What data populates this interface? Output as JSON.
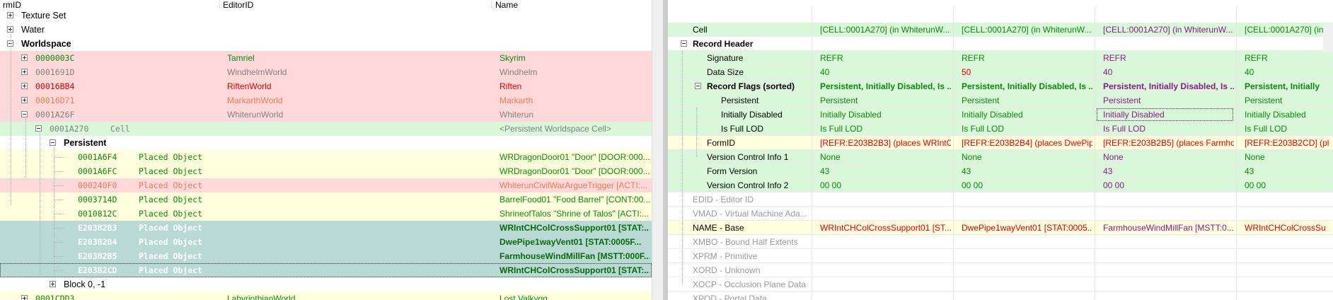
{
  "left_panel": {
    "columns": {
      "formid": "rmID",
      "editorid": "EditorID",
      "name": "Name"
    },
    "rows": [
      {
        "id": "",
        "label": "Texture Set",
        "editor": "",
        "name": "",
        "expander": "plus",
        "bold": false
      },
      {
        "id": "",
        "label": "Water",
        "editor": "",
        "name": "",
        "expander": "plus",
        "bold": false
      },
      {
        "id": "",
        "label": "Worldspace",
        "editor": "",
        "name": "",
        "expander": "minus",
        "bold": true
      },
      {
        "id": "0000003C",
        "label": "",
        "editor": "Tamriel",
        "name": "Skyrim",
        "expander": "plus",
        "bold": false
      },
      {
        "id": "0001691D",
        "label": "",
        "editor": "WindhelmWorld",
        "name": "Windhelm",
        "expander": "plus",
        "bold": false
      },
      {
        "id": "00016BB4",
        "label": "",
        "editor": "RiftenWorld",
        "name": "Riften",
        "expander": "plus",
        "bold": false
      },
      {
        "id": "00016D71",
        "label": "",
        "editor": "MarkarthWorld",
        "name": "Markarth",
        "expander": "plus",
        "bold": false
      },
      {
        "id": "0001A26F",
        "label": "",
        "editor": "WhiterunWorld",
        "name": "Whiterun",
        "expander": "minus",
        "bold": false
      },
      {
        "id": "0001A270",
        "label": "Cell",
        "editor": "",
        "name": "<Persistent Worldspace Cell>",
        "expander": "minus",
        "bold": false
      },
      {
        "id": "",
        "label": "Persistent",
        "editor": "",
        "name": "",
        "expander": "minus",
        "bold": true
      },
      {
        "id": "0001A6F4",
        "label": "Placed Object",
        "editor": "",
        "name": "WRDragonDoor01 \"Door\" [DOOR:000...",
        "expander": "",
        "bold": false
      },
      {
        "id": "0001A6FC",
        "label": "Placed Object",
        "editor": "",
        "name": "WRDragonDoor01 \"Door\" [DOOR:000...",
        "expander": "",
        "bold": false
      },
      {
        "id": "000240F0",
        "label": "Placed Object",
        "editor": "",
        "name": "WhiterunCivilWarArgueTrigger [ACTI:...",
        "expander": "",
        "bold": false
      },
      {
        "id": "0003714D",
        "label": "Placed Object",
        "editor": "",
        "name": "BarrelFood01 \"Food Barrel\" [CONT:00...",
        "expander": "",
        "bold": false
      },
      {
        "id": "0010812C",
        "label": "Placed Object",
        "editor": "",
        "name": "ShrineofTalos \"Shrine of Talos\" [ACTI:...",
        "expander": "",
        "bold": false
      },
      {
        "id": "E203B2B3",
        "label": "Placed Object",
        "editor": "",
        "name": "WRIntCHColCrossSupport01 [STAT:...",
        "expander": "",
        "bold": true
      },
      {
        "id": "E203B2B4",
        "label": "Placed Object",
        "editor": "",
        "name": "DwePipe1wayVent01 [STAT:0005F...",
        "expander": "",
        "bold": true
      },
      {
        "id": "E203B2B5",
        "label": "Placed Object",
        "editor": "",
        "name": "FarmhouseWindMillFan [MSTT:000F...",
        "expander": "",
        "bold": true
      },
      {
        "id": "E203B2CD",
        "label": "Placed Object",
        "editor": "",
        "name": "WRIntCHColCrossSupport01 [STAT:...",
        "expander": "",
        "bold": true
      },
      {
        "id": "",
        "label": "Block 0, -1",
        "editor": "",
        "name": "",
        "expander": "plus",
        "bold": false
      },
      {
        "id": "0001CDD3",
        "label": "",
        "editor": "LabyrinthianWorld",
        "name": "Lost Valkygg",
        "expander": "plus",
        "bold": false
      }
    ],
    "colors": {
      "green_text": "#0a8a0a",
      "gray_text": "#808080",
      "red_text": "#e00000",
      "orange_text": "#f07a50",
      "bg_pink": "#ffd9d9",
      "bg_green": "#d9f7d9",
      "bg_yellow": "#ffffdd",
      "bg_teal": "#b8d9d4"
    }
  },
  "right_panel": {
    "rows": [
      {
        "label": "Cell",
        "values": [
          "[CELL:0001A270] (in WhiterunW...",
          "[CELL:0001A270] (in WhiterunW...",
          "[CELL:0001A270] (in WhiterunW...",
          "[CELL:0001A270] (in WhiterunW..."
        ]
      },
      {
        "label": "Record Header",
        "values": [
          "",
          "",
          "",
          ""
        ]
      },
      {
        "label": "Signature",
        "values": [
          "REFR",
          "REFR",
          "REFR",
          "REFR"
        ]
      },
      {
        "label": "Data Size",
        "values": [
          "40",
          "50",
          "40",
          "40"
        ]
      },
      {
        "label": "Record Flags (sorted)",
        "values": [
          "Persistent, Initially Disabled, Is ...",
          "Persistent, Initially Disabled, Is ...",
          "Persistent, Initially Disabled, Is ...",
          "Persistent, Initially"
        ]
      },
      {
        "label": "Persistent",
        "values": [
          "Persistent",
          "Persistent",
          "Persistent",
          "Persistent"
        ]
      },
      {
        "label": "Initially Disabled",
        "values": [
          "Initially Disabled",
          "Initially Disabled",
          "Initially Disabled",
          "Initially Disabled"
        ]
      },
      {
        "label": "Is Full LOD",
        "values": [
          "Is Full LOD",
          "Is Full LOD",
          "Is Full LOD",
          "Is Full LOD"
        ]
      },
      {
        "label": "FormID",
        "values": [
          "[REFR:E203B2B3] (places WRIntC...",
          "[REFR:E203B2B4] (places DwePip...",
          "[REFR:E203B2B5] (places Farmho...",
          "[REFR:E203B2CD] (pl"
        ]
      },
      {
        "label": "Version Control Info 1",
        "values": [
          "None",
          "None",
          "None",
          "None"
        ]
      },
      {
        "label": "Form Version",
        "values": [
          "43",
          "43",
          "43",
          "43"
        ]
      },
      {
        "label": "Version Control Info 2",
        "values": [
          "00 00",
          "00 00",
          "00 00",
          "00 00"
        ]
      },
      {
        "label": "EDID - Editor ID",
        "values": [
          "",
          "",
          "",
          ""
        ]
      },
      {
        "label": "VMAD - Virtual Machine Ada...",
        "values": [
          "",
          "",
          "",
          ""
        ]
      },
      {
        "label": "NAME - Base",
        "values": [
          "WRIntCHColCrossSupport01 [ST...",
          "DwePipe1wayVent01 [STAT:0005...",
          "FarmhouseWindMillFan [MSTT:0...",
          "WRIntCHColCrossSu"
        ]
      },
      {
        "label": "XMBO - Bound Half Extents",
        "values": [
          "",
          "",
          "",
          ""
        ]
      },
      {
        "label": "XPRM - Primitive",
        "values": [
          "",
          "",
          "",
          ""
        ]
      },
      {
        "label": "XORD - Unknown",
        "values": [
          "",
          "",
          "",
          ""
        ]
      },
      {
        "label": "XOCP - Occlusion Plane Data",
        "values": [
          "",
          "",
          "",
          ""
        ]
      },
      {
        "label": "XPOD - Portal Data",
        "values": [
          "",
          "",
          "",
          ""
        ]
      }
    ],
    "colors": {
      "green_text": "#0a8a0a",
      "red_text": "#e00000",
      "purple_text": "#8a1a8a",
      "gray_text": "#9a9a9a",
      "bg_green": "#d9f7d9",
      "bg_yellow": "#ffffdd"
    }
  }
}
